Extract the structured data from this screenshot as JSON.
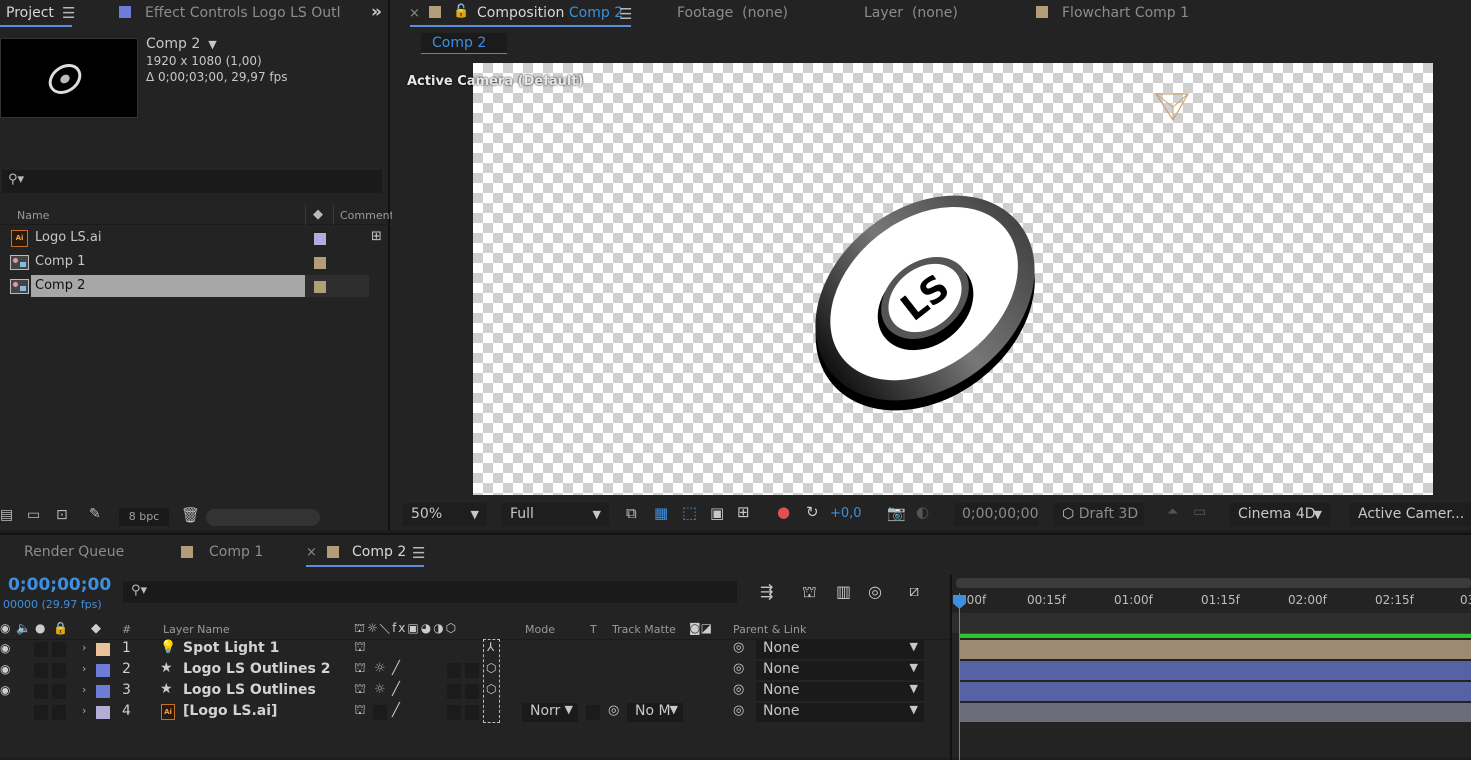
{
  "project": {
    "tab_label": "Project",
    "effect_tab_label": "Effect Controls Logo LS Outlines",
    "comp_name": "Comp 2",
    "resolution": "1920 x 1080 (1,00)",
    "duration": "Δ 0;00;03;00, 29,97 fps",
    "columns": {
      "name": "Name",
      "comment": "Comment"
    },
    "items": [
      {
        "name": "Logo LS.ai",
        "type": "ai",
        "label_color": "#b2aed6"
      },
      {
        "name": "Comp 1",
        "type": "comp",
        "label_color": "#b39d79"
      },
      {
        "name": "Comp 2",
        "type": "comp",
        "label_color": "#b39d79"
      }
    ],
    "bpc": "8 bpc"
  },
  "composition": {
    "tabs": {
      "composition_prefix": "Composition",
      "composition_name": "Comp 2",
      "footage_prefix": "Footage",
      "footage_value": "(none)",
      "layer_prefix": "Layer",
      "layer_value": "(none)",
      "flowchart_prefix": "Flowchart",
      "flowchart_value": "Comp 1"
    },
    "sub_tab": "Comp 2",
    "camera_label": "Active Camera (Default)",
    "logo_text": "LS",
    "toolbar": {
      "zoom": "50%",
      "resolution": "Full",
      "exposure": "+0,0",
      "timecode": "0;00;00;00",
      "renderer_mode": "Draft 3D",
      "renderer": "Cinema 4D",
      "view": "Active Camer..."
    }
  },
  "timeline": {
    "tabs": {
      "render_queue": "Render Queue",
      "comp1": "Comp 1",
      "comp2": "Comp 2"
    },
    "timecode": "0;00;00;00",
    "frame_info": "00000 (29.97 fps)",
    "columns": {
      "number": "#",
      "layer_name": "Layer Name",
      "mode": "Mode",
      "t": "T",
      "track_matte": "Track Matte",
      "parent_link": "Parent & Link"
    },
    "ruler_ticks": [
      "0:00f",
      "00:15f",
      "01:00f",
      "01:15f",
      "02:00f",
      "02:15f",
      "03"
    ],
    "layers": [
      {
        "num": "1",
        "name": "Spot Light 1",
        "label_color": "#e8c39a",
        "parent": "None",
        "bar_color": "#9d8a72",
        "kind": "light"
      },
      {
        "num": "2",
        "name": "Logo LS Outlines 2",
        "label_color": "#6f7bd9",
        "parent": "None",
        "bar_color": "#5662a3",
        "kind": "shape"
      },
      {
        "num": "3",
        "name": "Logo LS Outlines",
        "label_color": "#6f7bd9",
        "parent": "None",
        "bar_color": "#5662a3",
        "kind": "shape"
      },
      {
        "num": "4",
        "name": "[Logo LS.ai]",
        "label_color": "#b2aed6",
        "parent": "None",
        "bar_color": "#6d6d7a",
        "kind": "ai",
        "mode": "Norr",
        "track_matte": "No M"
      }
    ]
  }
}
